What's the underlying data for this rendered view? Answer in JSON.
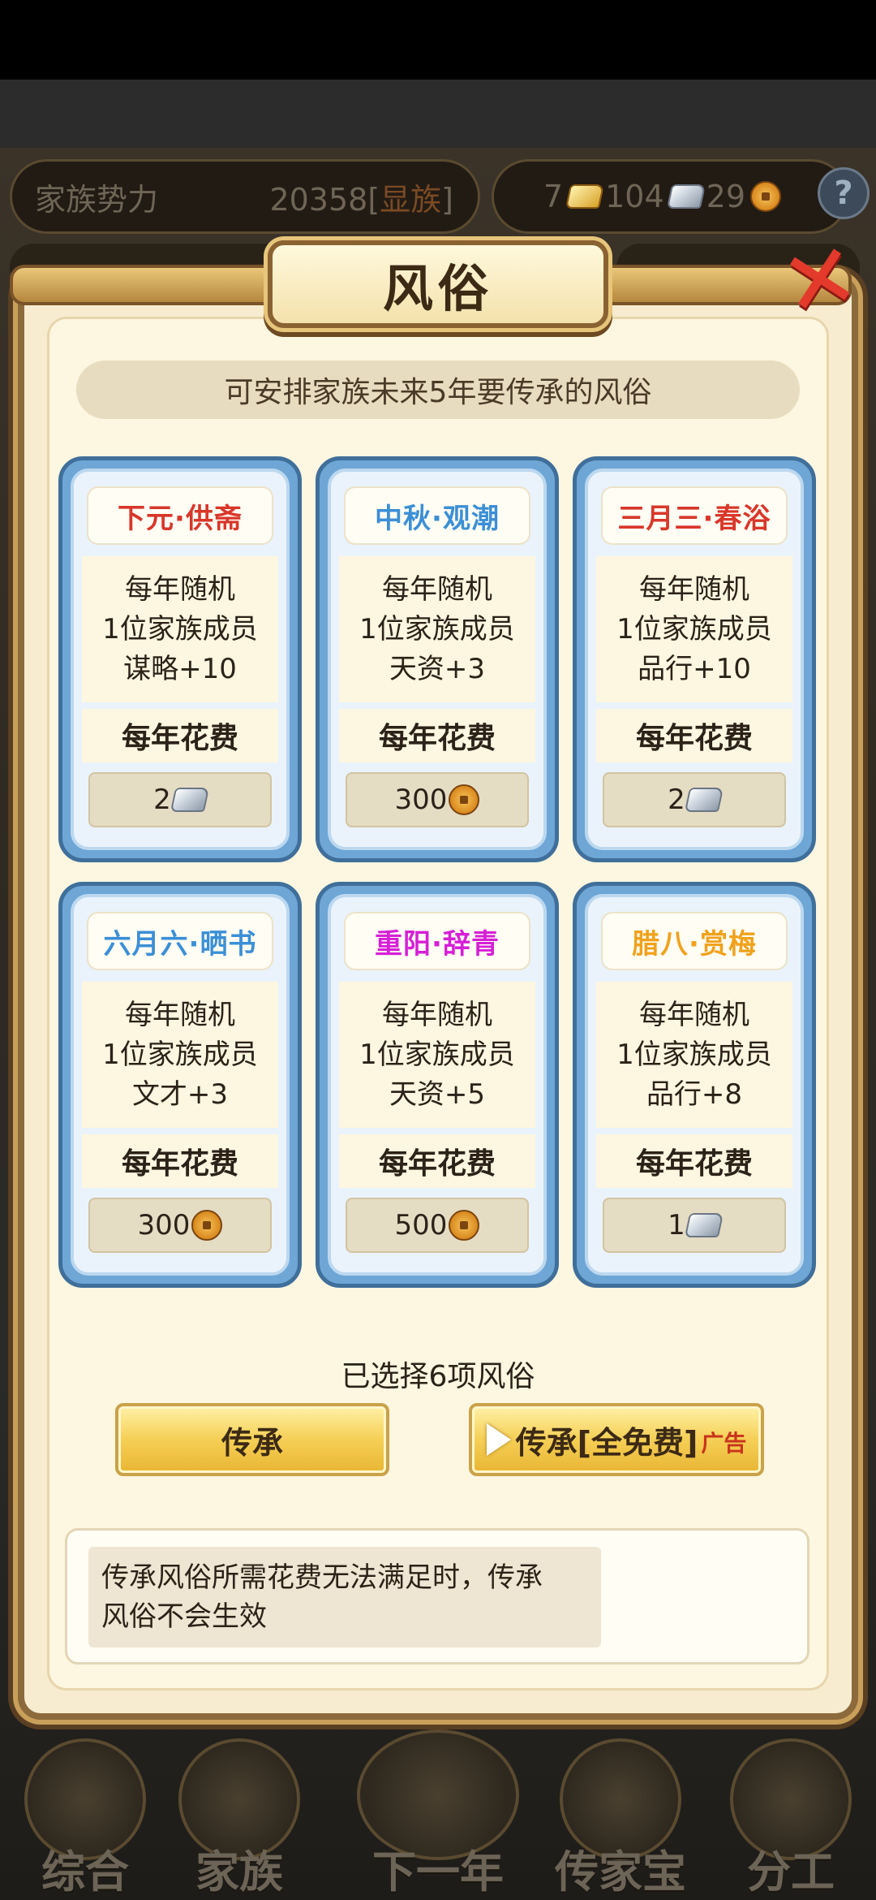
{
  "background": {
    "power_label": "家族势力",
    "power_value": "20358",
    "power_rank_open": "[",
    "power_rank": "显族",
    "power_rank_close": "]",
    "resource_gold": "7",
    "resource_silver": "104",
    "resource_coin": "29",
    "help": "?"
  },
  "modal": {
    "title": "风俗",
    "close": "✕",
    "subtitle": "可安排家族未来5年要传承的风俗",
    "cards": [
      {
        "title": "下元·供斋",
        "title_color": "#d8372a",
        "line1": "每年随机",
        "line2": "1位家族成员",
        "effect": "谋略+10",
        "cost_label": "每年花费",
        "cost": "2",
        "currency": "silver-ingot"
      },
      {
        "title": "中秋·观潮",
        "title_color": "#3b8fd6",
        "line1": "每年随机",
        "line2": "1位家族成员",
        "effect": "天资+3",
        "cost_label": "每年花费",
        "cost": "300",
        "currency": "copper-coin"
      },
      {
        "title": "三月三·春浴",
        "title_color": "#d8372a",
        "line1": "每年随机",
        "line2": "1位家族成员",
        "effect": "品行+10",
        "cost_label": "每年花费",
        "cost": "2",
        "currency": "silver-ingot"
      },
      {
        "title": "六月六·晒书",
        "title_color": "#3b8fd6",
        "line1": "每年随机",
        "line2": "1位家族成员",
        "effect": "文才+3",
        "cost_label": "每年花费",
        "cost": "300",
        "currency": "copper-coin"
      },
      {
        "title": "重阳·辞青",
        "title_color": "#d61fd6",
        "line1": "每年随机",
        "line2": "1位家族成员",
        "effect": "天资+5",
        "cost_label": "每年花费",
        "cost": "500",
        "currency": "copper-coin"
      },
      {
        "title": "腊八·赏梅",
        "title_color": "#f0a21c",
        "line1": "每年随机",
        "line2": "1位家族成员",
        "effect": "品行+8",
        "cost_label": "每年花费",
        "cost": "1",
        "currency": "silver-ingot"
      }
    ],
    "selected_text": "已选择6项风俗",
    "inherit_button": "传承",
    "free_button": "传承[全免费]",
    "ad_tag": "广告",
    "notice_line1": "传承风俗所需花费无法满足时，传承",
    "notice_line2": "风俗不会生效"
  },
  "bottom_nav": {
    "items": [
      "综合",
      "家族",
      "下一年",
      "传家宝",
      "分工"
    ]
  }
}
